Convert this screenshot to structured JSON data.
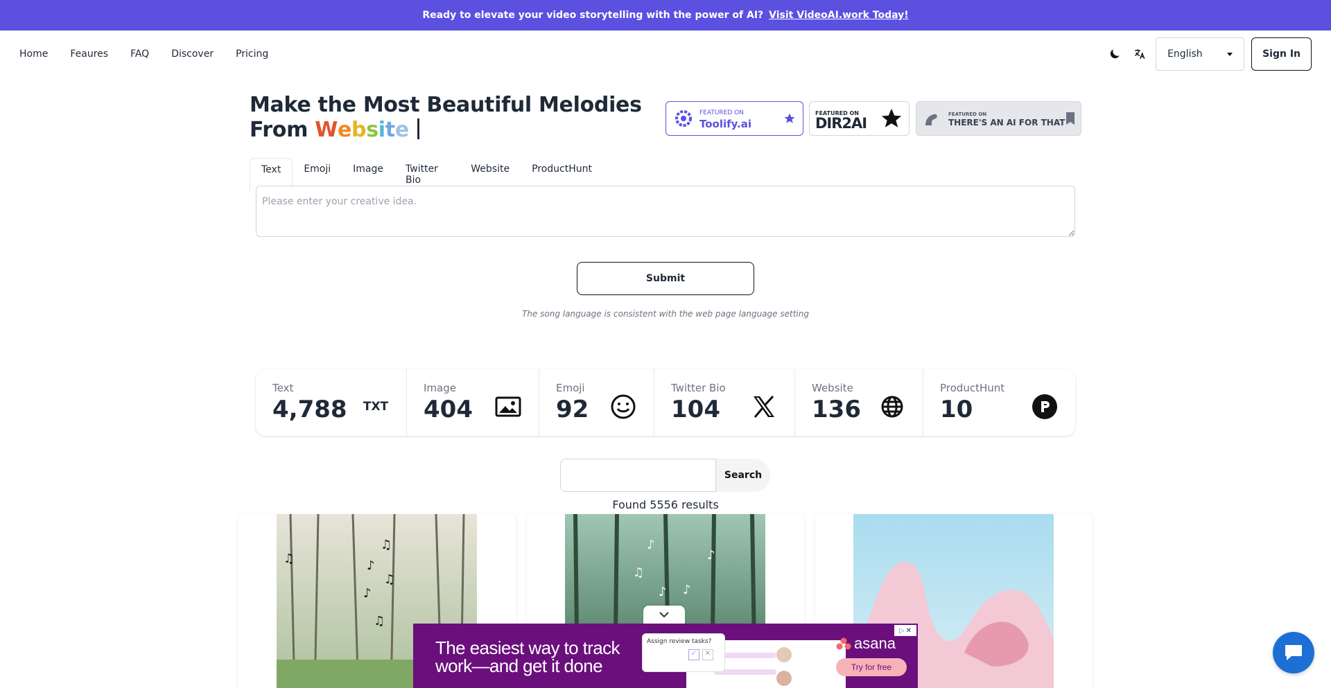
{
  "banner": {
    "text": "Ready to elevate your video storytelling with the power of AI?",
    "link": "Visit VideoAI.work Today!"
  },
  "nav": {
    "links": [
      "Home",
      "Feaures",
      "FAQ",
      "Discover",
      "Pricing"
    ],
    "language": "English",
    "sign_in": "Sign In"
  },
  "hero": {
    "title_line1": "Make the Most Beautiful Melodies",
    "title_prefix": "From",
    "rotating_word": [
      "W",
      "e",
      "b",
      "s",
      "i",
      "t",
      "e"
    ],
    "rainbow_colors": [
      "#e0532c",
      "#f08a24",
      "#e6b422",
      "#8cc63f",
      "#4fb8d6",
      "#6fa8dc",
      "#9bc4e2"
    ]
  },
  "badges": {
    "toolify_small": "FEATURED ON",
    "toolify_big": "Toolify.ai",
    "dir_small": "FEATURED ON",
    "dir_big": "DIR2AI",
    "taaft_small": "FEATURED ON",
    "taaft_big": "THERE'S AN AI FOR THAT"
  },
  "tabs": [
    "Text",
    "Emoji",
    "Image",
    "Twitter Bio",
    "Website",
    "ProductHunt"
  ],
  "active_tab": "Text",
  "input": {
    "placeholder": "Please enter your creative idea."
  },
  "submit_label": "Submit",
  "hint": "The song language is consistent with the web page language setting",
  "stats": [
    {
      "label": "Text",
      "value": "4,788",
      "icon": "txt-icon"
    },
    {
      "label": "Image",
      "value": "404",
      "icon": "image-icon"
    },
    {
      "label": "Emoji",
      "value": "92",
      "icon": "smiley-icon"
    },
    {
      "label": "Twitter Bio",
      "value": "104",
      "icon": "x-logo-icon"
    },
    {
      "label": "Website",
      "value": "136",
      "icon": "globe-icon"
    },
    {
      "label": "ProductHunt",
      "value": "10",
      "icon": "producthunt-icon"
    }
  ],
  "stat_txt_glyph": "TXT",
  "search": {
    "button": "Search",
    "found": "Found 5556 results"
  },
  "ad": {
    "headline_1": "The easiest way to track",
    "headline_2": "work—and get it done",
    "popup": "Assign review tasks?",
    "brand": "asana",
    "cta": "Try for free"
  },
  "colors": {
    "accent": "#5b50e0",
    "ad_bg": "#6a0f7c",
    "chat": "#1d6fd6"
  }
}
